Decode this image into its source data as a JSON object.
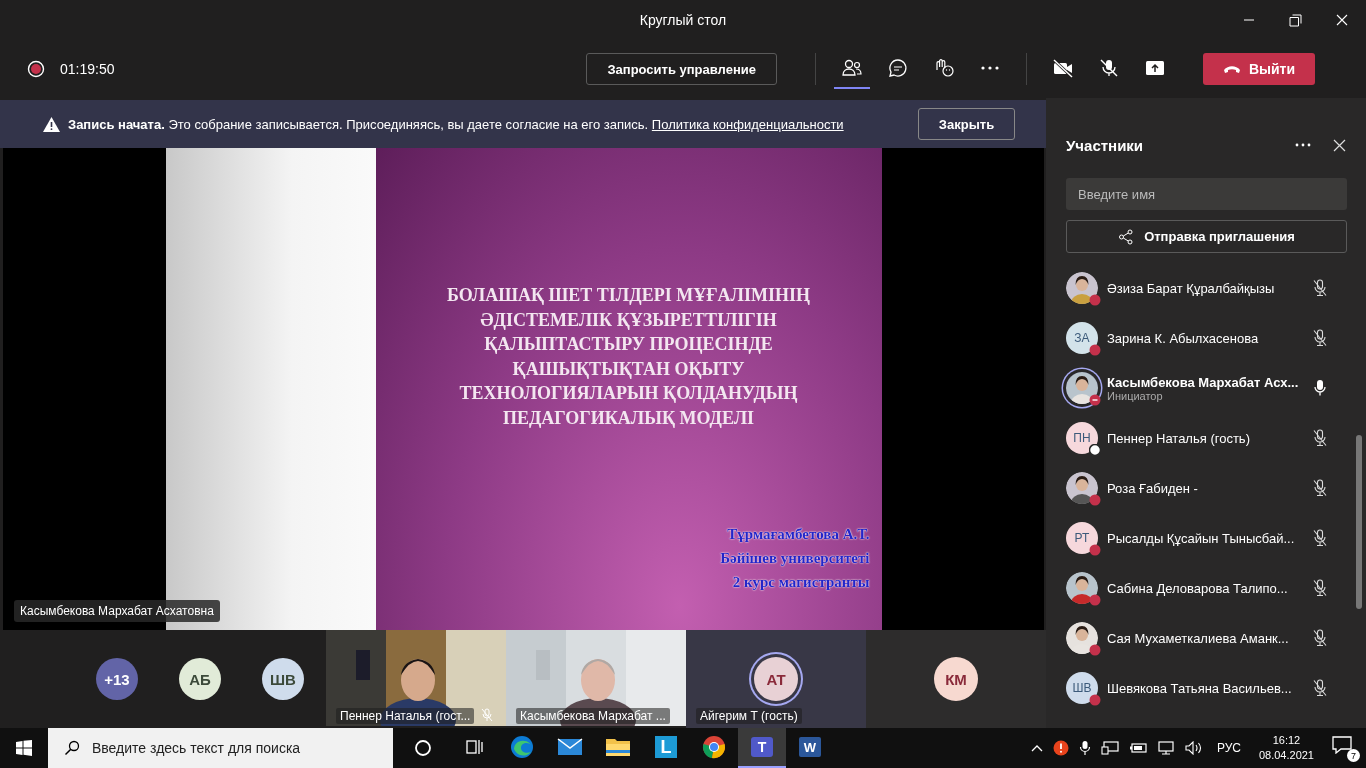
{
  "window": {
    "title": "Круглый стол"
  },
  "meeting_bar": {
    "recording": true,
    "timer": "01:19:50",
    "request_control": "Запросить управление",
    "tools": [
      {
        "kind": "participants",
        "selected": true
      },
      {
        "kind": "chat",
        "selected": false
      },
      {
        "kind": "reactions",
        "selected": false
      },
      {
        "kind": "more",
        "selected": false
      }
    ],
    "camera_on": false,
    "mic_on": false,
    "leave": "Выйти"
  },
  "banner": {
    "title": "Запись начата.",
    "text": "Это собрание записывается. Присоединяясь, вы даете согласие на его запись.",
    "link": "Политика конфиденциальности",
    "button": "Закрыть"
  },
  "stage": {
    "slide": {
      "title_lines": [
        "БОЛАШАҚ ШЕТ ТІЛДЕРІ МҰҒАЛІМІНІҢ",
        "ӘДІСТЕМЕЛІК ҚҰЗЫРЕТТІЛІГІН",
        "ҚАЛЫПТАСТЫРУ ПРОЦЕСІНДЕ",
        "ҚАШЫҚТЫҚТАН ОҚЫТУ",
        "ТЕХНОЛОГИЯЛАРЫН ҚОЛДАНУДЫҢ",
        "ПЕДАГОГИКАЛЫҚ МОДЕЛІ"
      ],
      "author_lines": [
        "Тұрмағамбетова А.Т.",
        "Бәйішев университеті",
        "2 курс магистранты"
      ]
    },
    "presenter": "Касымбекова Мархабат Асхатовна"
  },
  "gallery": [
    {
      "kind": "count",
      "label": "+13",
      "color": "#6264a7"
    },
    {
      "kind": "avatar",
      "label": "АБ",
      "color": "#e1ebd8"
    },
    {
      "kind": "avatar",
      "label": "ШВ",
      "color": "#cfdcec"
    },
    {
      "kind": "video",
      "name": "Пеннер Наталья (гост...",
      "muted": true
    },
    {
      "kind": "video",
      "name": "Касымбекова Мархабат ...",
      "muted": false
    },
    {
      "kind": "tile",
      "label": "АТ",
      "color": "#e8d1d5",
      "name": "Айгерим Т (гость)",
      "speaking": true
    },
    {
      "kind": "tile",
      "label": "КМ",
      "color": "#f7d9d0",
      "speaking": false
    }
  ],
  "participants_panel": {
    "title": "Участники",
    "search_placeholder": "Введите имя",
    "invite": "Отправка приглашения",
    "people": [
      {
        "name": "Әзиза Барат Құралбайқызы",
        "presence": {
          "kind": "busy",
          "color": "#c4314b"
        },
        "muted": true
      },
      {
        "name": "Зарина К. Абылхасенова",
        "avatar": {
          "kind": "initials",
          "initials": "ЗА",
          "color": "#d3e3ea"
        },
        "presence": {
          "kind": "busy",
          "color": "#c4314b"
        },
        "muted": true
      },
      {
        "name": "Касымбекова Мархабат Асх...",
        "role": "Инициатор",
        "presence": {
          "kind": "dnd",
          "color": "#c4314b"
        },
        "muted": false,
        "organizer": true
      },
      {
        "name": "Пеннер Наталья (гость)",
        "avatar": {
          "kind": "initials",
          "initials": "ПН",
          "color": "#f6d8dc"
        },
        "presence": {
          "kind": "offline",
          "color": "#ffffff"
        },
        "muted": true
      },
      {
        "name": "Роза Ғабиден -",
        "presence": {
          "kind": "busy",
          "color": "#c4314b"
        },
        "muted": true
      },
      {
        "name": "Рысалды Құсайын Тынысбай...",
        "avatar": {
          "kind": "initials",
          "initials": "РТ",
          "color": "#f6d8dc"
        },
        "presence": {
          "kind": "busy",
          "color": "#c4314b"
        },
        "muted": true
      },
      {
        "name": "Сабина Деловарова Талипо...",
        "presence": {
          "kind": "busy",
          "color": "#c4314b"
        },
        "muted": true
      },
      {
        "name": "Сая Мухаметкалиева Аманк...",
        "presence": {
          "kind": "busy",
          "color": "#c4314b"
        },
        "muted": true
      },
      {
        "name": "Шевякова Татьяна Васильев...",
        "avatar": {
          "kind": "initials",
          "initials": "ШВ",
          "color": "#cfdcec"
        },
        "presence": {
          "kind": "busy",
          "color": "#c4314b"
        },
        "muted": true
      }
    ]
  },
  "taskbar": {
    "search_placeholder": "Введите здесь текст для поиска",
    "apps": [
      {
        "kind": "taskview",
        "selected": false
      },
      {
        "kind": "edge",
        "selected": false
      },
      {
        "kind": "mail",
        "selected": false
      },
      {
        "kind": "explorer",
        "selected": false
      },
      {
        "kind": "l-app",
        "label": "L",
        "selected": false
      },
      {
        "kind": "chrome",
        "selected": false
      },
      {
        "kind": "teams",
        "label": "T",
        "selected": true
      },
      {
        "kind": "word",
        "label": "W",
        "selected": false
      }
    ],
    "language": "РУС",
    "time": "16:12",
    "date": "08.04.2021",
    "notifications": "7"
  }
}
